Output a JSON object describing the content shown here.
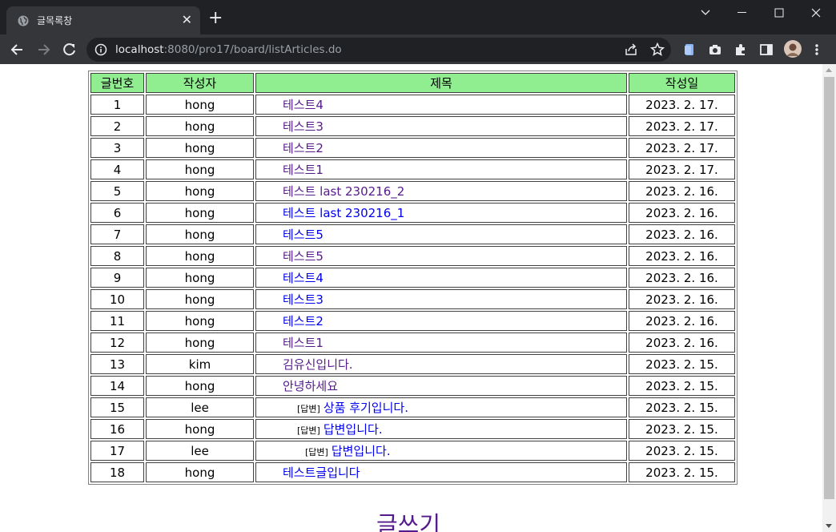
{
  "browser": {
    "tab_title": "글목록창",
    "url_host": "localhost",
    "url_rest": ":8080/pro17/board/listArticles.do"
  },
  "table": {
    "headers": [
      "글번호",
      "작성자",
      "제목",
      "작성일"
    ],
    "rows": [
      {
        "no": "1",
        "writer": "hong",
        "title": "테스트4",
        "date": "2023. 2. 17.",
        "visited": true,
        "reply": ""
      },
      {
        "no": "2",
        "writer": "hong",
        "title": "테스트3",
        "date": "2023. 2. 17.",
        "visited": true,
        "reply": ""
      },
      {
        "no": "3",
        "writer": "hong",
        "title": "테스트2",
        "date": "2023. 2. 17.",
        "visited": true,
        "reply": ""
      },
      {
        "no": "4",
        "writer": "hong",
        "title": "테스트1",
        "date": "2023. 2. 17.",
        "visited": true,
        "reply": ""
      },
      {
        "no": "5",
        "writer": "hong",
        "title": "테스트 last 230216_2",
        "date": "2023. 2. 16.",
        "visited": true,
        "reply": ""
      },
      {
        "no": "6",
        "writer": "hong",
        "title": "테스트 last 230216_1",
        "date": "2023. 2. 16.",
        "visited": false,
        "reply": ""
      },
      {
        "no": "7",
        "writer": "hong",
        "title": "테스트5",
        "date": "2023. 2. 16.",
        "visited": false,
        "reply": ""
      },
      {
        "no": "8",
        "writer": "hong",
        "title": "테스트5",
        "date": "2023. 2. 16.",
        "visited": true,
        "reply": ""
      },
      {
        "no": "9",
        "writer": "hong",
        "title": "테스트4",
        "date": "2023. 2. 16.",
        "visited": false,
        "reply": ""
      },
      {
        "no": "10",
        "writer": "hong",
        "title": "테스트3",
        "date": "2023. 2. 16.",
        "visited": false,
        "reply": ""
      },
      {
        "no": "11",
        "writer": "hong",
        "title": "테스트2",
        "date": "2023. 2. 16.",
        "visited": false,
        "reply": ""
      },
      {
        "no": "12",
        "writer": "hong",
        "title": "테스트1",
        "date": "2023. 2. 16.",
        "visited": true,
        "reply": ""
      },
      {
        "no": "13",
        "writer": "kim",
        "title": "김유신입니다.",
        "date": "2023. 2. 15.",
        "visited": true,
        "reply": ""
      },
      {
        "no": "14",
        "writer": "hong",
        "title": "안녕하세요",
        "date": "2023. 2. 15.",
        "visited": true,
        "reply": ""
      },
      {
        "no": "15",
        "writer": "lee",
        "title": "상품 후기입니다.",
        "date": "2023. 2. 15.",
        "visited": false,
        "reply": "[답변]"
      },
      {
        "no": "16",
        "writer": "hong",
        "title": "답변입니다.",
        "date": "2023. 2. 15.",
        "visited": false,
        "reply": "[답변]"
      },
      {
        "no": "17",
        "writer": "lee",
        "title": "답변입니다.",
        "date": "2023. 2. 15.",
        "visited": false,
        "reply": "[답변]"
      },
      {
        "no": "18",
        "writer": "hong",
        "title": "테스트글입니다",
        "date": "2023. 2. 15.",
        "visited": false,
        "reply": ""
      }
    ]
  },
  "write_link": "글쓰기",
  "colors": {
    "header_bg": "#90ee90",
    "link": "#0000ee",
    "visited_link": "#551a8b"
  },
  "icons": [
    "globe-icon",
    "close-icon",
    "new-tab-icon",
    "back-icon",
    "forward-icon",
    "reload-icon",
    "info-icon",
    "share-icon",
    "star-icon",
    "extension-icon",
    "camera-icon",
    "puzzle-icon",
    "sidepanel-icon",
    "avatar",
    "menu-icon"
  ]
}
